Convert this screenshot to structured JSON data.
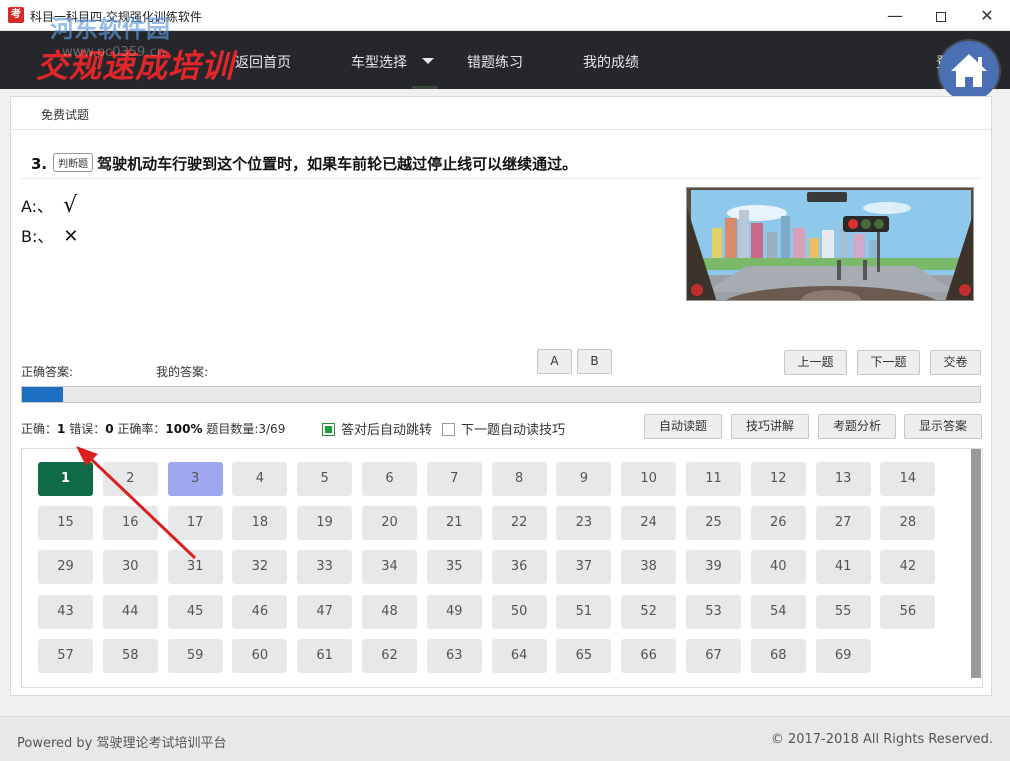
{
  "window": {
    "title": "科目一科目四 交规强化训练软件",
    "app_icon_char": "考",
    "min_glyph": "—",
    "close_glyph": "✕"
  },
  "nav": {
    "logo": "交规速成培训",
    "watermark": "河东软件园",
    "watermark_url": "www.pc0359.cn",
    "items": [
      "返回首页",
      "车型选择",
      "错题练习",
      "我的成绩"
    ],
    "right_text": "登"
  },
  "breadcrumb": "免费试题",
  "question": {
    "number": "3.",
    "type_tag": "判断题",
    "text": "驾驶机动车行驶到这个位置时，如果车前轮已越过停止线可以继续通过。",
    "options": [
      {
        "label": "A:、",
        "symbol": "√"
      },
      {
        "label": "B:、",
        "symbol": "✕"
      }
    ]
  },
  "answer": {
    "correct_label": "正确答案:",
    "mine_label": "我的答案:",
    "choice_buttons": [
      "A",
      "B"
    ]
  },
  "nav_buttons": [
    "上一题",
    "下一题",
    "交卷"
  ],
  "progress": {
    "fraction": 0.043
  },
  "stats": {
    "correct_label": "正确：",
    "correct": "1",
    "wrong_label": "错误：",
    "wrong": "0",
    "rate_label": "正确率：",
    "rate": "100%",
    "count_label": "题目数量:",
    "count": "3/69"
  },
  "checkboxes": [
    {
      "label": "答对后自动跳转",
      "checked": true
    },
    {
      "label": "下一题自动读技巧",
      "checked": false
    }
  ],
  "tool_buttons": [
    "自动读题",
    "技巧讲解",
    "考题分析",
    "显示答案"
  ],
  "grid": {
    "total": 69,
    "current": 1,
    "viewed": [
      3
    ],
    "per_row": 14
  },
  "footer": {
    "left": "Powered by 驾驶理论考试培训平台",
    "right": "© 2017-2018 All Rights Reserved."
  },
  "colors": {
    "nav_bg": "#25272b",
    "logo_red": "#e0262b",
    "current_cell": "#0f6b45",
    "viewed_cell": "#9fa8ef",
    "progress": "#1e6fc1"
  }
}
